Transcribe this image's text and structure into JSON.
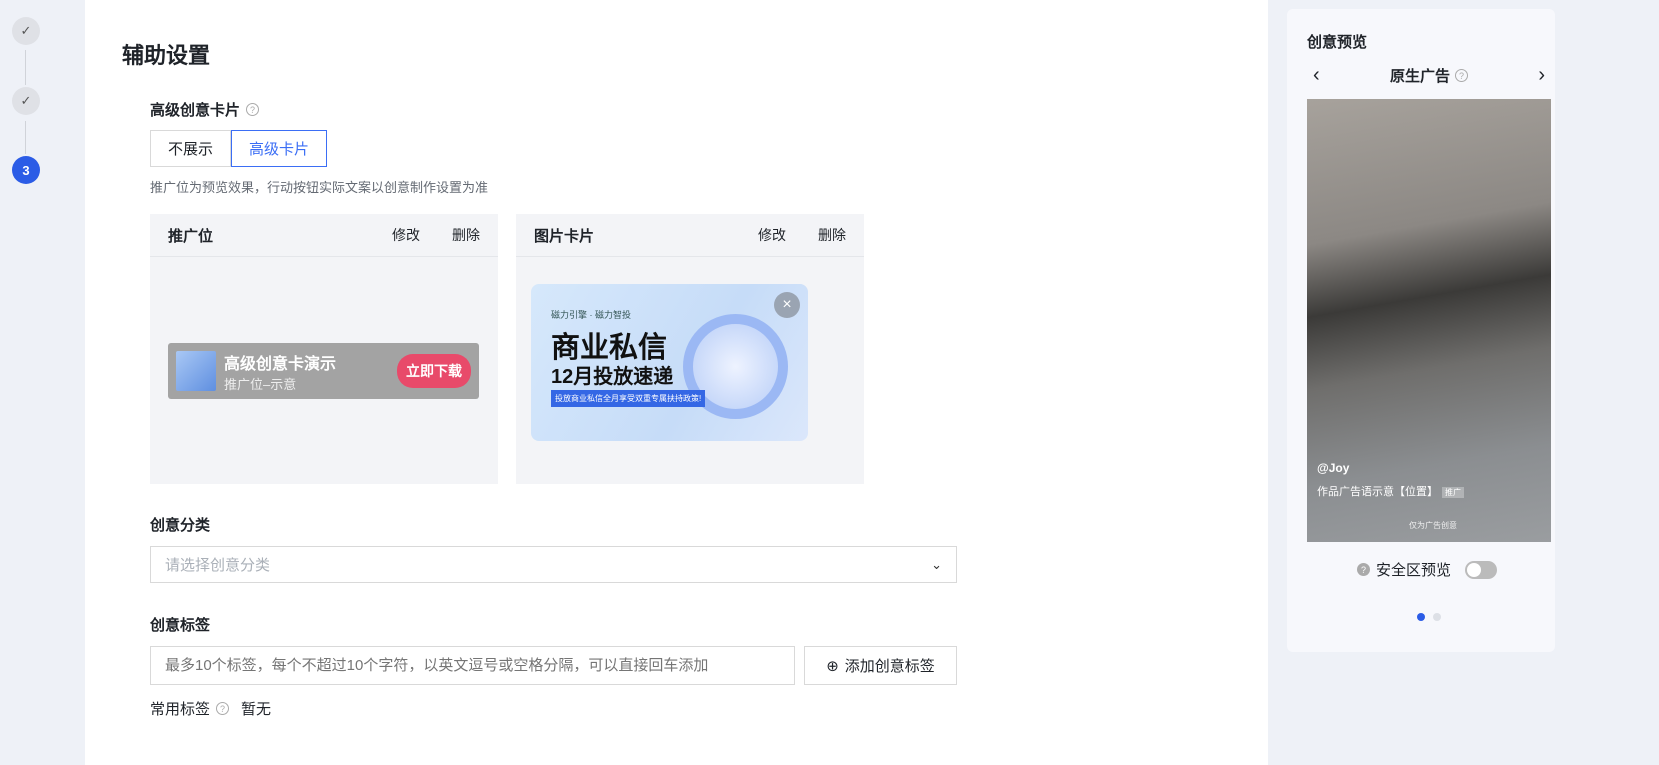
{
  "stepper": {
    "steps": [
      {
        "state": "done",
        "label": "✓"
      },
      {
        "state": "done",
        "label": "✓"
      },
      {
        "state": "active",
        "label": "3"
      }
    ]
  },
  "page_title": "辅助设置",
  "advanced_card": {
    "label": "高级创意卡片",
    "options": [
      "不展示",
      "高级卡片"
    ],
    "selected": "高级卡片",
    "hint": "推广位为预览效果，行动按钮实际文案以创意制作设置为准"
  },
  "cards": [
    {
      "title": "推广位",
      "edit": "修改",
      "delete": "删除",
      "promo": {
        "title": "高级创意卡演示",
        "subtitle": "推广位–示意",
        "button": "立即下载"
      }
    },
    {
      "title": "图片卡片",
      "edit": "修改",
      "delete": "删除",
      "banner": {
        "brand": "磁力引擎 · 磁力智投",
        "headline": "商业私信",
        "subheadline": "12月投放速递",
        "strip": "投放商业私信全月享受双重专属扶持政策!",
        "close": "×"
      }
    }
  ],
  "category": {
    "label": "创意分类",
    "placeholder": "请选择创意分类"
  },
  "tags": {
    "label": "创意标签",
    "placeholder": "最多10个标签，每个不超过10个字符，以英文逗号或空格分隔，可以直接回车添加",
    "add_button": "添加创意标签",
    "common_label": "常用标签",
    "common_value": "暂无"
  },
  "preview": {
    "title": "创意预览",
    "type": "原生广告",
    "prev": "‹",
    "next": "›",
    "user": "@Joy",
    "caption": "作品广告语示意【位置】",
    "caption_tag": "推广",
    "note": "仅为广告创意",
    "safe_zone": "安全区预览",
    "safe_zone_on": false,
    "page": 1,
    "pages": 2
  },
  "colors": {
    "accent": "#2b5ce6",
    "cta": "#e84a6a"
  }
}
